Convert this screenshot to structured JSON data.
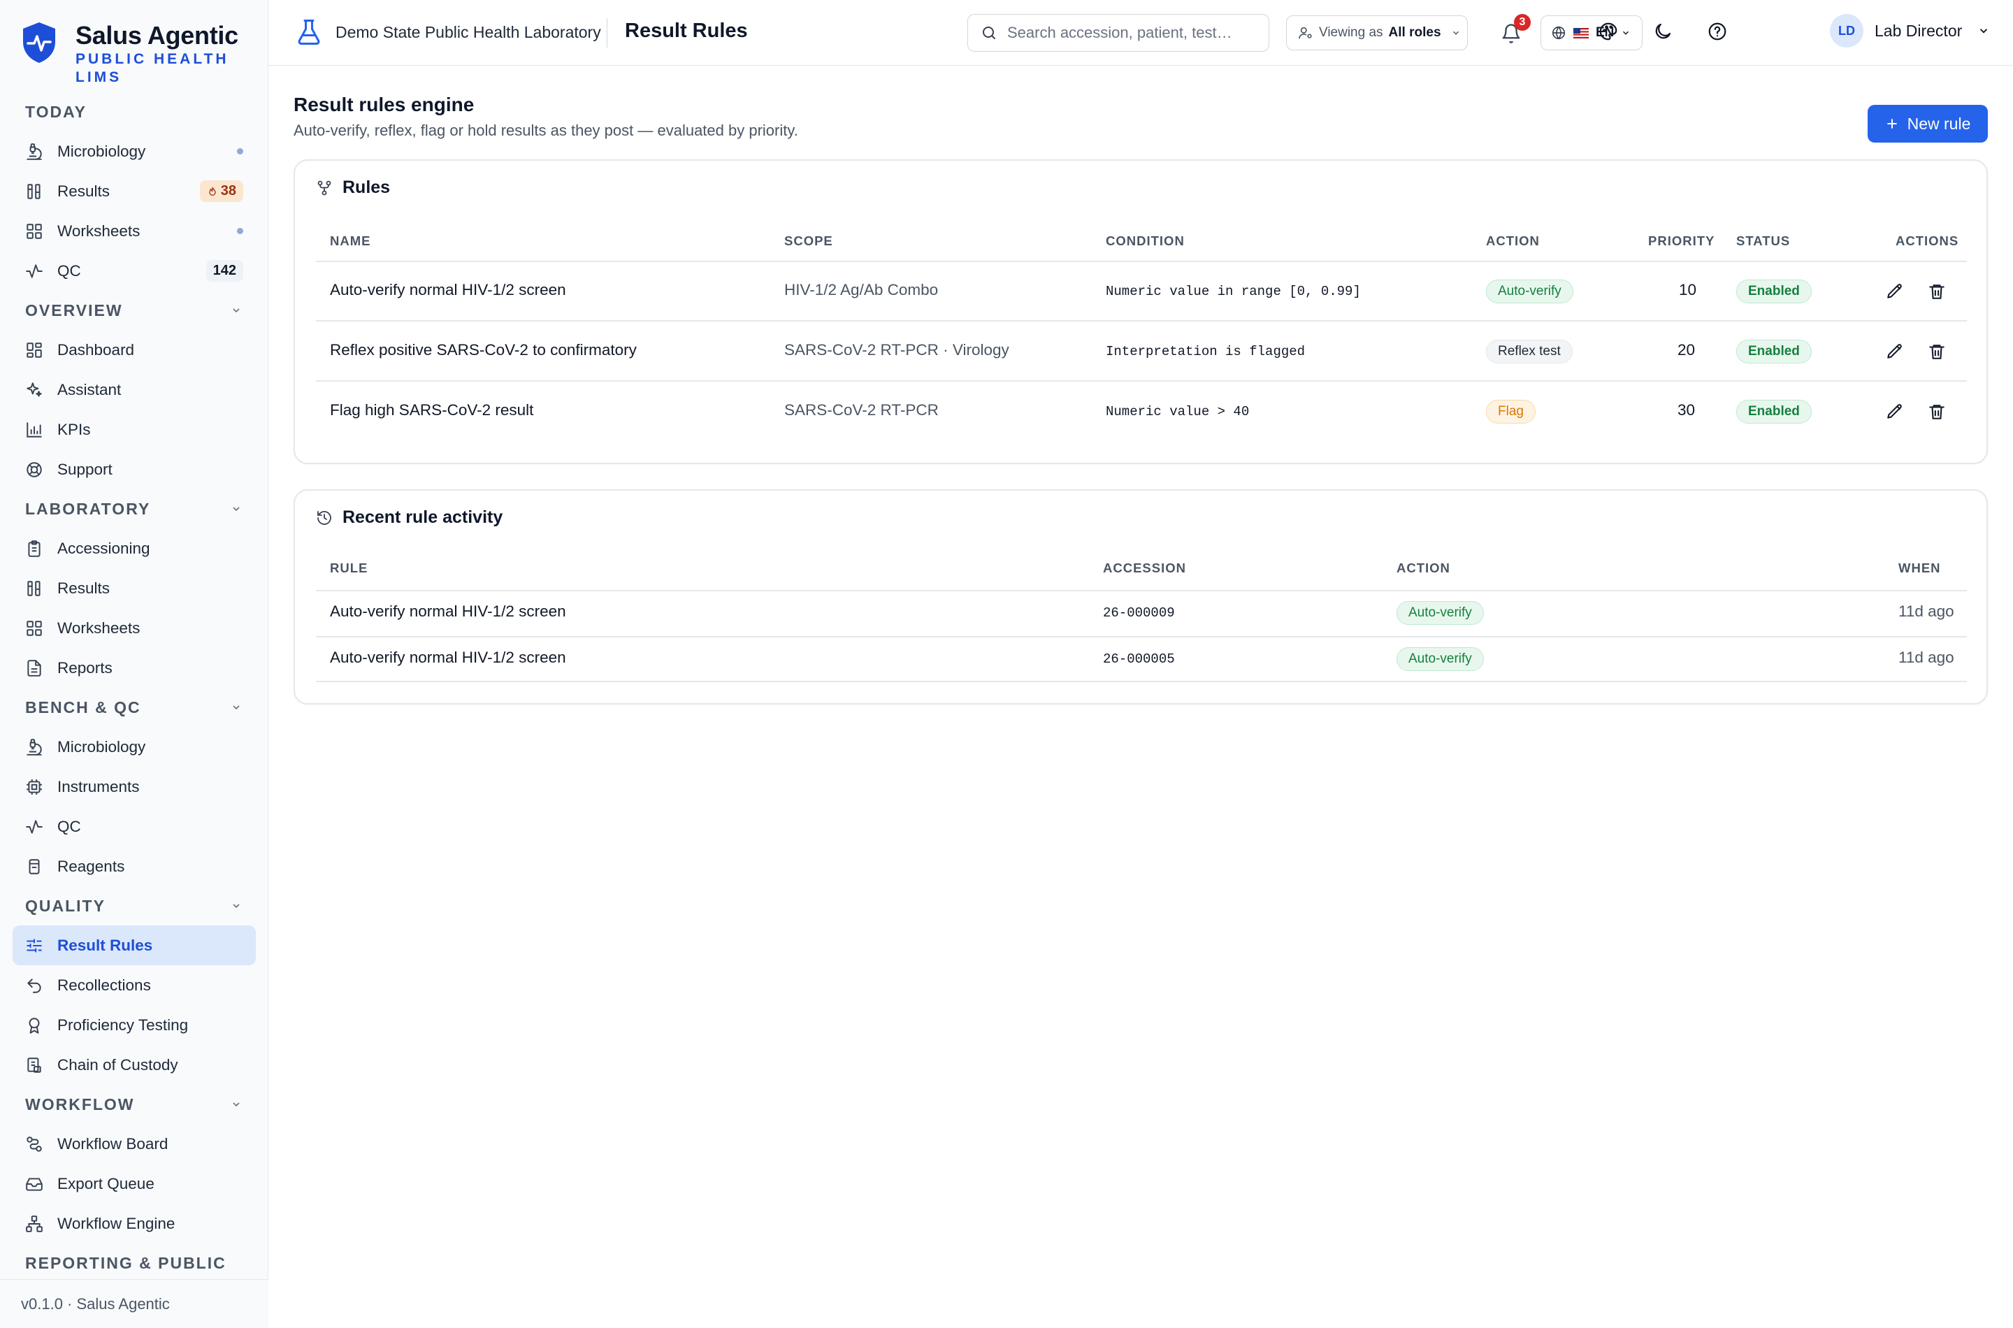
{
  "app": {
    "name": "Salus Agentic",
    "subtitle": "PUBLIC HEALTH LIMS",
    "version_footer": "v0.1.0 · Salus Agentic"
  },
  "header": {
    "lab_name": "Demo State Public Health Laboratory",
    "page_title": "Result Rules",
    "search_placeholder": "Search accession, patient, test…",
    "viewing_label": "Viewing as",
    "viewing_value": "All roles",
    "notification_count": "3",
    "language": "EN",
    "user_initials": "LD",
    "user_name": "Lab Director"
  },
  "sidebar": {
    "sections": {
      "today": "TODAY",
      "overview": "OVERVIEW",
      "laboratory": "LABORATORY",
      "bench": "BENCH & QC",
      "quality": "QUALITY",
      "workflow": "WORKFLOW",
      "reporting": "REPORTING & PUBLIC"
    },
    "today": [
      {
        "label": "Microbiology",
        "icon": "microscope-icon"
      },
      {
        "label": "Results",
        "icon": "columns-icon",
        "badge": "38"
      },
      {
        "label": "Worksheets",
        "icon": "grid-icon"
      },
      {
        "label": "QC",
        "icon": "activity-icon",
        "badge": "142"
      }
    ],
    "overview": [
      {
        "label": "Dashboard",
        "icon": "dashboard-icon"
      },
      {
        "label": "Assistant",
        "icon": "sparkles-icon"
      },
      {
        "label": "KPIs",
        "icon": "bar-chart-icon"
      },
      {
        "label": "Support",
        "icon": "lifebuoy-icon"
      }
    ],
    "laboratory": [
      {
        "label": "Accessioning",
        "icon": "clipboard-icon"
      },
      {
        "label": "Results",
        "icon": "columns-icon"
      },
      {
        "label": "Worksheets",
        "icon": "grid-icon"
      },
      {
        "label": "Reports",
        "icon": "file-text-icon"
      }
    ],
    "bench": [
      {
        "label": "Microbiology",
        "icon": "microscope-icon"
      },
      {
        "label": "Instruments",
        "icon": "cpu-icon"
      },
      {
        "label": "QC",
        "icon": "activity-icon"
      },
      {
        "label": "Reagents",
        "icon": "flask-icon"
      }
    ],
    "quality": [
      {
        "label": "Result Rules",
        "icon": "sliders-icon"
      },
      {
        "label": "Recollections",
        "icon": "undo-icon"
      },
      {
        "label": "Proficiency Testing",
        "icon": "award-icon"
      },
      {
        "label": "Chain of Custody",
        "icon": "custody-icon"
      }
    ],
    "workflow": [
      {
        "label": "Workflow Board",
        "icon": "route-icon"
      },
      {
        "label": "Export Queue",
        "icon": "inbox-icon"
      },
      {
        "label": "Workflow Engine",
        "icon": "network-icon"
      }
    ]
  },
  "main": {
    "title": "Result rules engine",
    "subtitle": "Auto-verify, reflex, flag or hold results as they post — evaluated by priority.",
    "new_rule_label": "New rule",
    "rules_card": {
      "title": "Rules",
      "columns": [
        "NAME",
        "SCOPE",
        "CONDITION",
        "ACTION",
        "PRIORITY",
        "STATUS",
        "ACTIONS"
      ],
      "rows": [
        {
          "name": "Auto-verify normal HIV-1/2 screen",
          "scope": "HIV-1/2 Ag/Ab Combo",
          "condition": "Numeric value in range [0, 0.99]",
          "action": "Auto-verify",
          "priority": "10",
          "status": "Enabled"
        },
        {
          "name": "Reflex positive SARS-CoV-2 to confirmatory",
          "scope": "SARS-CoV-2 RT-PCR · Virology",
          "condition": "Interpretation is flagged",
          "action": "Reflex test",
          "priority": "20",
          "status": "Enabled"
        },
        {
          "name": "Flag high SARS-CoV-2 result",
          "scope": "SARS-CoV-2 RT-PCR",
          "condition": "Numeric value > 40",
          "action": "Flag",
          "priority": "30",
          "status": "Enabled"
        }
      ]
    },
    "activity_card": {
      "title": "Recent rule activity",
      "columns": [
        "RULE",
        "ACCESSION",
        "ACTION",
        "WHEN"
      ],
      "rows": [
        {
          "rule": "Auto-verify normal HIV-1/2 screen",
          "accession": "26-000009",
          "action": "Auto-verify",
          "when": "11d ago"
        },
        {
          "rule": "Auto-verify normal HIV-1/2 screen",
          "accession": "26-000005",
          "action": "Auto-verify",
          "when": "11d ago"
        }
      ]
    }
  },
  "colors": {
    "accent": "#2563eb",
    "active_nav_bg": "#dbe7fb",
    "success": "#15803d",
    "warning": "#d97706",
    "danger": "#dc2626"
  }
}
